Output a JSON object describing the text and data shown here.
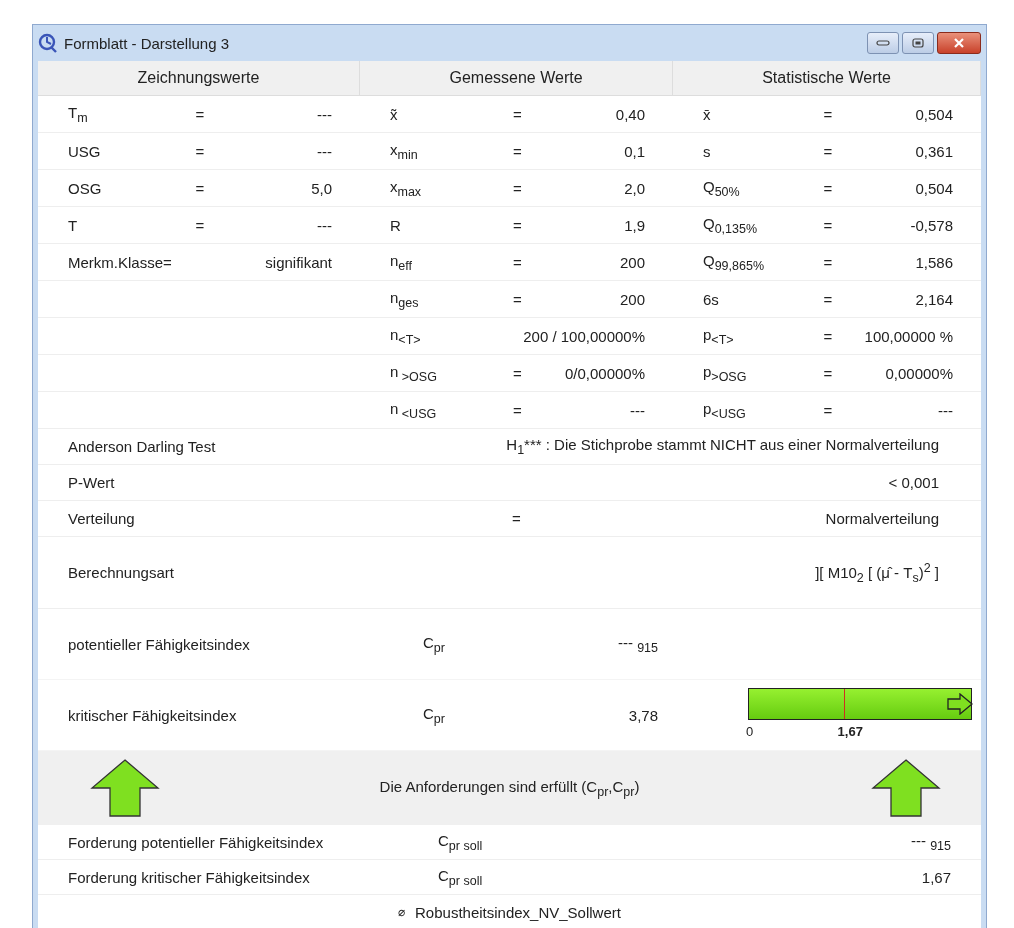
{
  "window": {
    "title": "Formblatt - Darstellung 3"
  },
  "columns": [
    {
      "title": "Zeichnungswerte",
      "rows": [
        {
          "label": "T$_{m}$",
          "eq": "=",
          "value": "---"
        },
        {
          "label": "USG",
          "eq": "=",
          "value": "---"
        },
        {
          "label": "OSG",
          "eq": "=",
          "value": "5,0"
        },
        {
          "label": "T",
          "eq": "=",
          "value": "---"
        },
        {
          "label": "Merkm.Klasse=",
          "value": "signifikant"
        }
      ]
    },
    {
      "title": "Gemessene Werte",
      "rows": [
        {
          "label": "x̃",
          "eq": "=",
          "value": "0,40"
        },
        {
          "label": "x$_{min}$",
          "eq": "=",
          "value": "0,1"
        },
        {
          "label": "x$_{max}$",
          "eq": "=",
          "value": "2,0"
        },
        {
          "label": "R",
          "eq": "=",
          "value": "1,9"
        },
        {
          "label": "n$_{eff}$",
          "eq": "=",
          "value": "200"
        },
        {
          "label": "n$_{ges}$",
          "eq": "=",
          "value": "200"
        },
        {
          "label": "n$_{<T>}$",
          "value": "200 / 100,00000%"
        },
        {
          "label": "n$_{ >OSG}$",
          "eq": "=",
          "value": "0/0,00000%"
        },
        {
          "label": "n$_{ <USG}$",
          "eq": "=",
          "value": "---"
        }
      ]
    },
    {
      "title": "Statistische Werte",
      "rows": [
        {
          "label": "x̄",
          "eq": "=",
          "value": "0,504"
        },
        {
          "label": "s",
          "eq": "=",
          "value": "0,361"
        },
        {
          "label": "Q$_{50%}$",
          "eq": "=",
          "value": "0,504"
        },
        {
          "label": "Q$_{0,135%}$",
          "eq": "=",
          "value": "-0,578"
        },
        {
          "label": "Q$_{99,865%}$",
          "eq": "=",
          "value": "1,586"
        },
        {
          "label": "6s",
          "eq": "=",
          "value": "2,164"
        },
        {
          "label": "p$_{<T>}$",
          "eq": "=",
          "value": "100,00000 %"
        },
        {
          "label": "p$_{>OSG}$",
          "eq": "=",
          "value": "0,00000%"
        },
        {
          "label": "p$_{<USG}$",
          "eq": "=",
          "value": "---"
        }
      ]
    }
  ],
  "details": [
    {
      "kind": "wide",
      "label": "Anderson Darling Test",
      "value": "H$_{1}$*** : Die Stichprobe stammt NICHT aus einer Normalverteilung"
    },
    {
      "kind": "plain",
      "label": "P-Wert",
      "value": "< 0,001"
    },
    {
      "kind": "plain",
      "label": "Verteilung",
      "eq": "=",
      "value": "Normalverteilung"
    },
    {
      "kind": "tall",
      "label": "Berechnungsart",
      "value": "][ M10$_{2}$  [ (μ̂ - T$_{s}$)$^{2}$ ]"
    },
    {
      "kind": "index",
      "label": "potentieller Fähigkeitsindex",
      "symbol": "C$_{pr}$",
      "value": "--- $_{915}$"
    },
    {
      "kind": "index",
      "label": "kritischer Fähigkeitsindex",
      "symbol": "C$_{pr}$",
      "value": "3,78",
      "gauge": {
        "level": 1,
        "overflow": true,
        "ticks": [
          "0",
          "1,67"
        ]
      }
    },
    {
      "kind": "banner",
      "passed": true,
      "text": "Die Anforderungen sind erfüllt (C$_{pr}$,C$_{pr}$)"
    },
    {
      "kind": "requirement",
      "label": "Forderung potentieller Fähigkeitsindex",
      "symbol": "C$_{pr soll}$",
      "value": "--- $_{915}$"
    },
    {
      "kind": "requirement",
      "label": "Forderung kritischer Fähigkeitsindex",
      "symbol": "C$_{pr soll}$",
      "value": "1,67"
    },
    {
      "kind": "footer",
      "symbol": "⌀",
      "text": "Robustheitsindex_NV_Sollwert"
    }
  ]
}
